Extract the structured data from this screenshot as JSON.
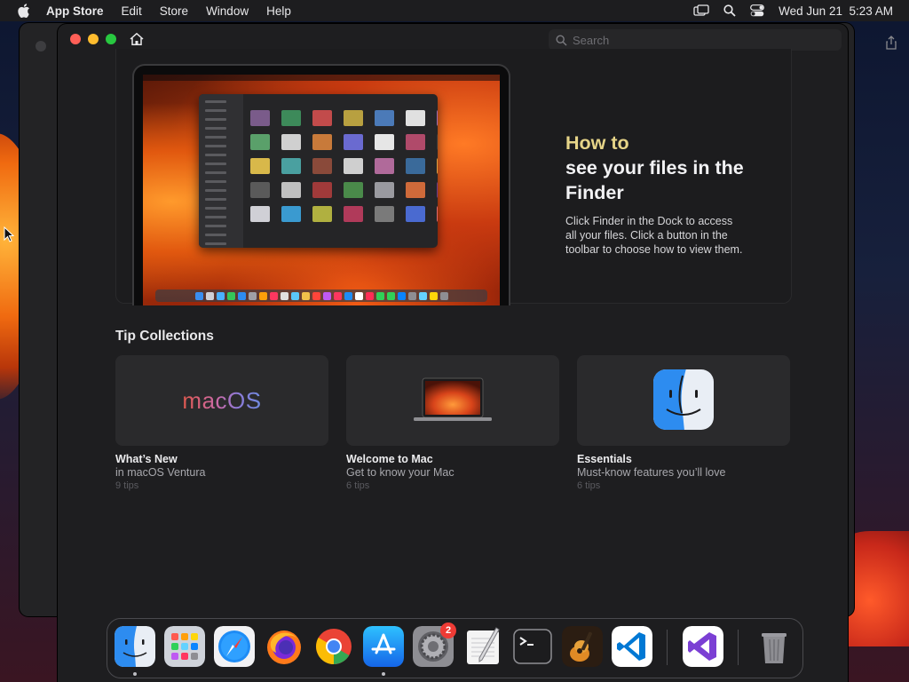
{
  "menubar": {
    "app_name": "App Store",
    "menus": [
      "Edit",
      "Store",
      "Window",
      "Help"
    ],
    "datetime": "Wed Jun 21  5:23 AM"
  },
  "toolbar": {
    "search_placeholder": "Search"
  },
  "hero": {
    "title_accent": "How to",
    "title_main": "see your files in the Finder",
    "body": "Click Finder in the Dock to access all your files. Click a button in the toolbar to choose how to view them."
  },
  "tip_collections": {
    "heading": "Tip Collections",
    "cards": [
      {
        "title": "What’s New",
        "subtitle": "in macOS Ventura",
        "count": "9 tips",
        "art_text": "macOS"
      },
      {
        "title": "Welcome to Mac",
        "subtitle": "Get to know your Mac",
        "count": "6 tips"
      },
      {
        "title": "Essentials",
        "subtitle": "Must-know features you’ll love",
        "count": "6 tips"
      }
    ]
  },
  "dock": {
    "apps": [
      "Finder",
      "Launchpad",
      "Safari",
      "Firefox",
      "Chrome",
      "App Store",
      "System Settings",
      "TextEdit",
      "Terminal",
      "GarageBand",
      "Visual Studio Code",
      "Visual Studio",
      "Trash"
    ],
    "settings_badge": "2"
  },
  "colors": {
    "hero_accent": "#e6d488",
    "window_bg": "#1e1e20",
    "card_bg": "#2a2a2c",
    "badge_red": "#ee3b35"
  }
}
